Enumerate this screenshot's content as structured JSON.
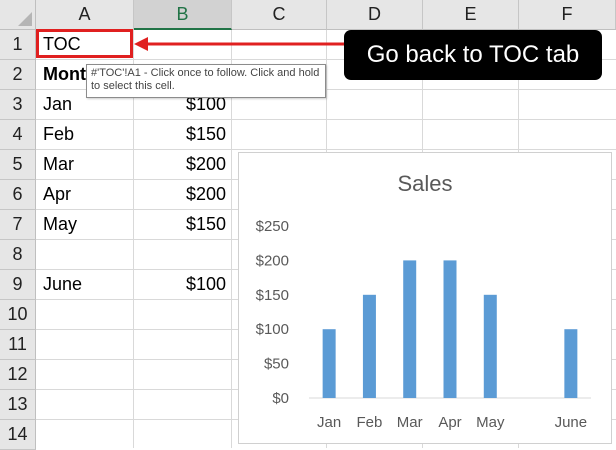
{
  "columns": [
    "A",
    "B",
    "C",
    "D",
    "E",
    "F"
  ],
  "rows": [
    "1",
    "2",
    "3",
    "4",
    "5",
    "6",
    "7",
    "8",
    "9",
    "10",
    "11",
    "12",
    "13",
    "14"
  ],
  "cells": {
    "a1": "TOC",
    "a2": "Mont",
    "a3": "Jan",
    "b3": "$100",
    "a4": "Feb",
    "b4": "$150",
    "a5": "Mar",
    "b5": "$200",
    "a6": "Apr",
    "b6": "$200",
    "a7": "May",
    "b7": "$150",
    "a9": "June",
    "b9": "$100"
  },
  "tooltip": "#'TOC'!A1 - Click once to follow. Click and hold to select this cell.",
  "callout": "Go back to TOC tab",
  "colors": {
    "accent_red": "#e02020",
    "bar": "#5b9bd5",
    "selected_header": "#217346"
  },
  "chart_data": {
    "type": "bar",
    "title": "Sales",
    "categories": [
      "Jan",
      "Feb",
      "Mar",
      "Apr",
      "May",
      "",
      "June"
    ],
    "values": [
      100,
      150,
      200,
      200,
      150,
      null,
      100
    ],
    "yticks": [
      "$0",
      "$50",
      "$100",
      "$150",
      "$200",
      "$250"
    ],
    "ylim": [
      0,
      250
    ],
    "grid": false,
    "legend": "none"
  }
}
